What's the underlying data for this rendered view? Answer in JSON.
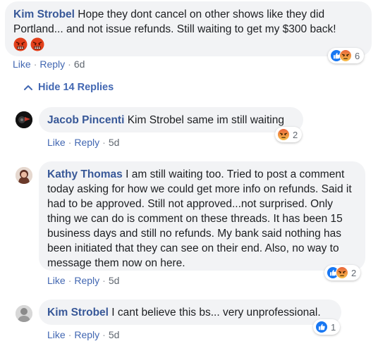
{
  "comments": [
    {
      "author": "Kim Strobel",
      "text": "Hope they dont cancel on other shows like they did Portland... and not issue refunds. Still waiting to get my $300 back!",
      "emojis": [
        "angry-face-icon",
        "angry-face-icon"
      ],
      "like": "Like",
      "reply": "Reply",
      "time": "6d",
      "reactions": [
        "like",
        "angry"
      ],
      "reaction_count": "6"
    }
  ],
  "hide_replies_label": "Hide 14 Replies",
  "replies": [
    {
      "author": "Jacob Pincenti",
      "text": "Kim Strobel same im still waiting",
      "like": "Like",
      "reply": "Reply",
      "time": "5d",
      "reactions": [
        "angry"
      ],
      "reaction_count": "2"
    },
    {
      "author": "Kathy Thomas",
      "text": "I am still waiting too. Tried to post a comment today asking for how we could get more info on refunds. Said it had to be approved. Still not approved...not surprised. Only thing we can do is comment on these threads. It has been 15 business days and still no refunds. My bank said nothing has been initiated that they can see on their end. Also, no way to message them now on here.",
      "like": "Like",
      "reply": "Reply",
      "time": "5d",
      "reactions": [
        "like",
        "angry"
      ],
      "reaction_count": "2"
    },
    {
      "author": "Kim Strobel",
      "text": "I cant believe this bs... very unprofessional.",
      "like": "Like",
      "reply": "Reply",
      "time": "5d",
      "reactions": [
        "like"
      ],
      "reaction_count": "1"
    }
  ],
  "colors": {
    "link": "#4267b2",
    "author": "#385898",
    "bubble": "#f2f3f5",
    "meta": "#606770"
  }
}
